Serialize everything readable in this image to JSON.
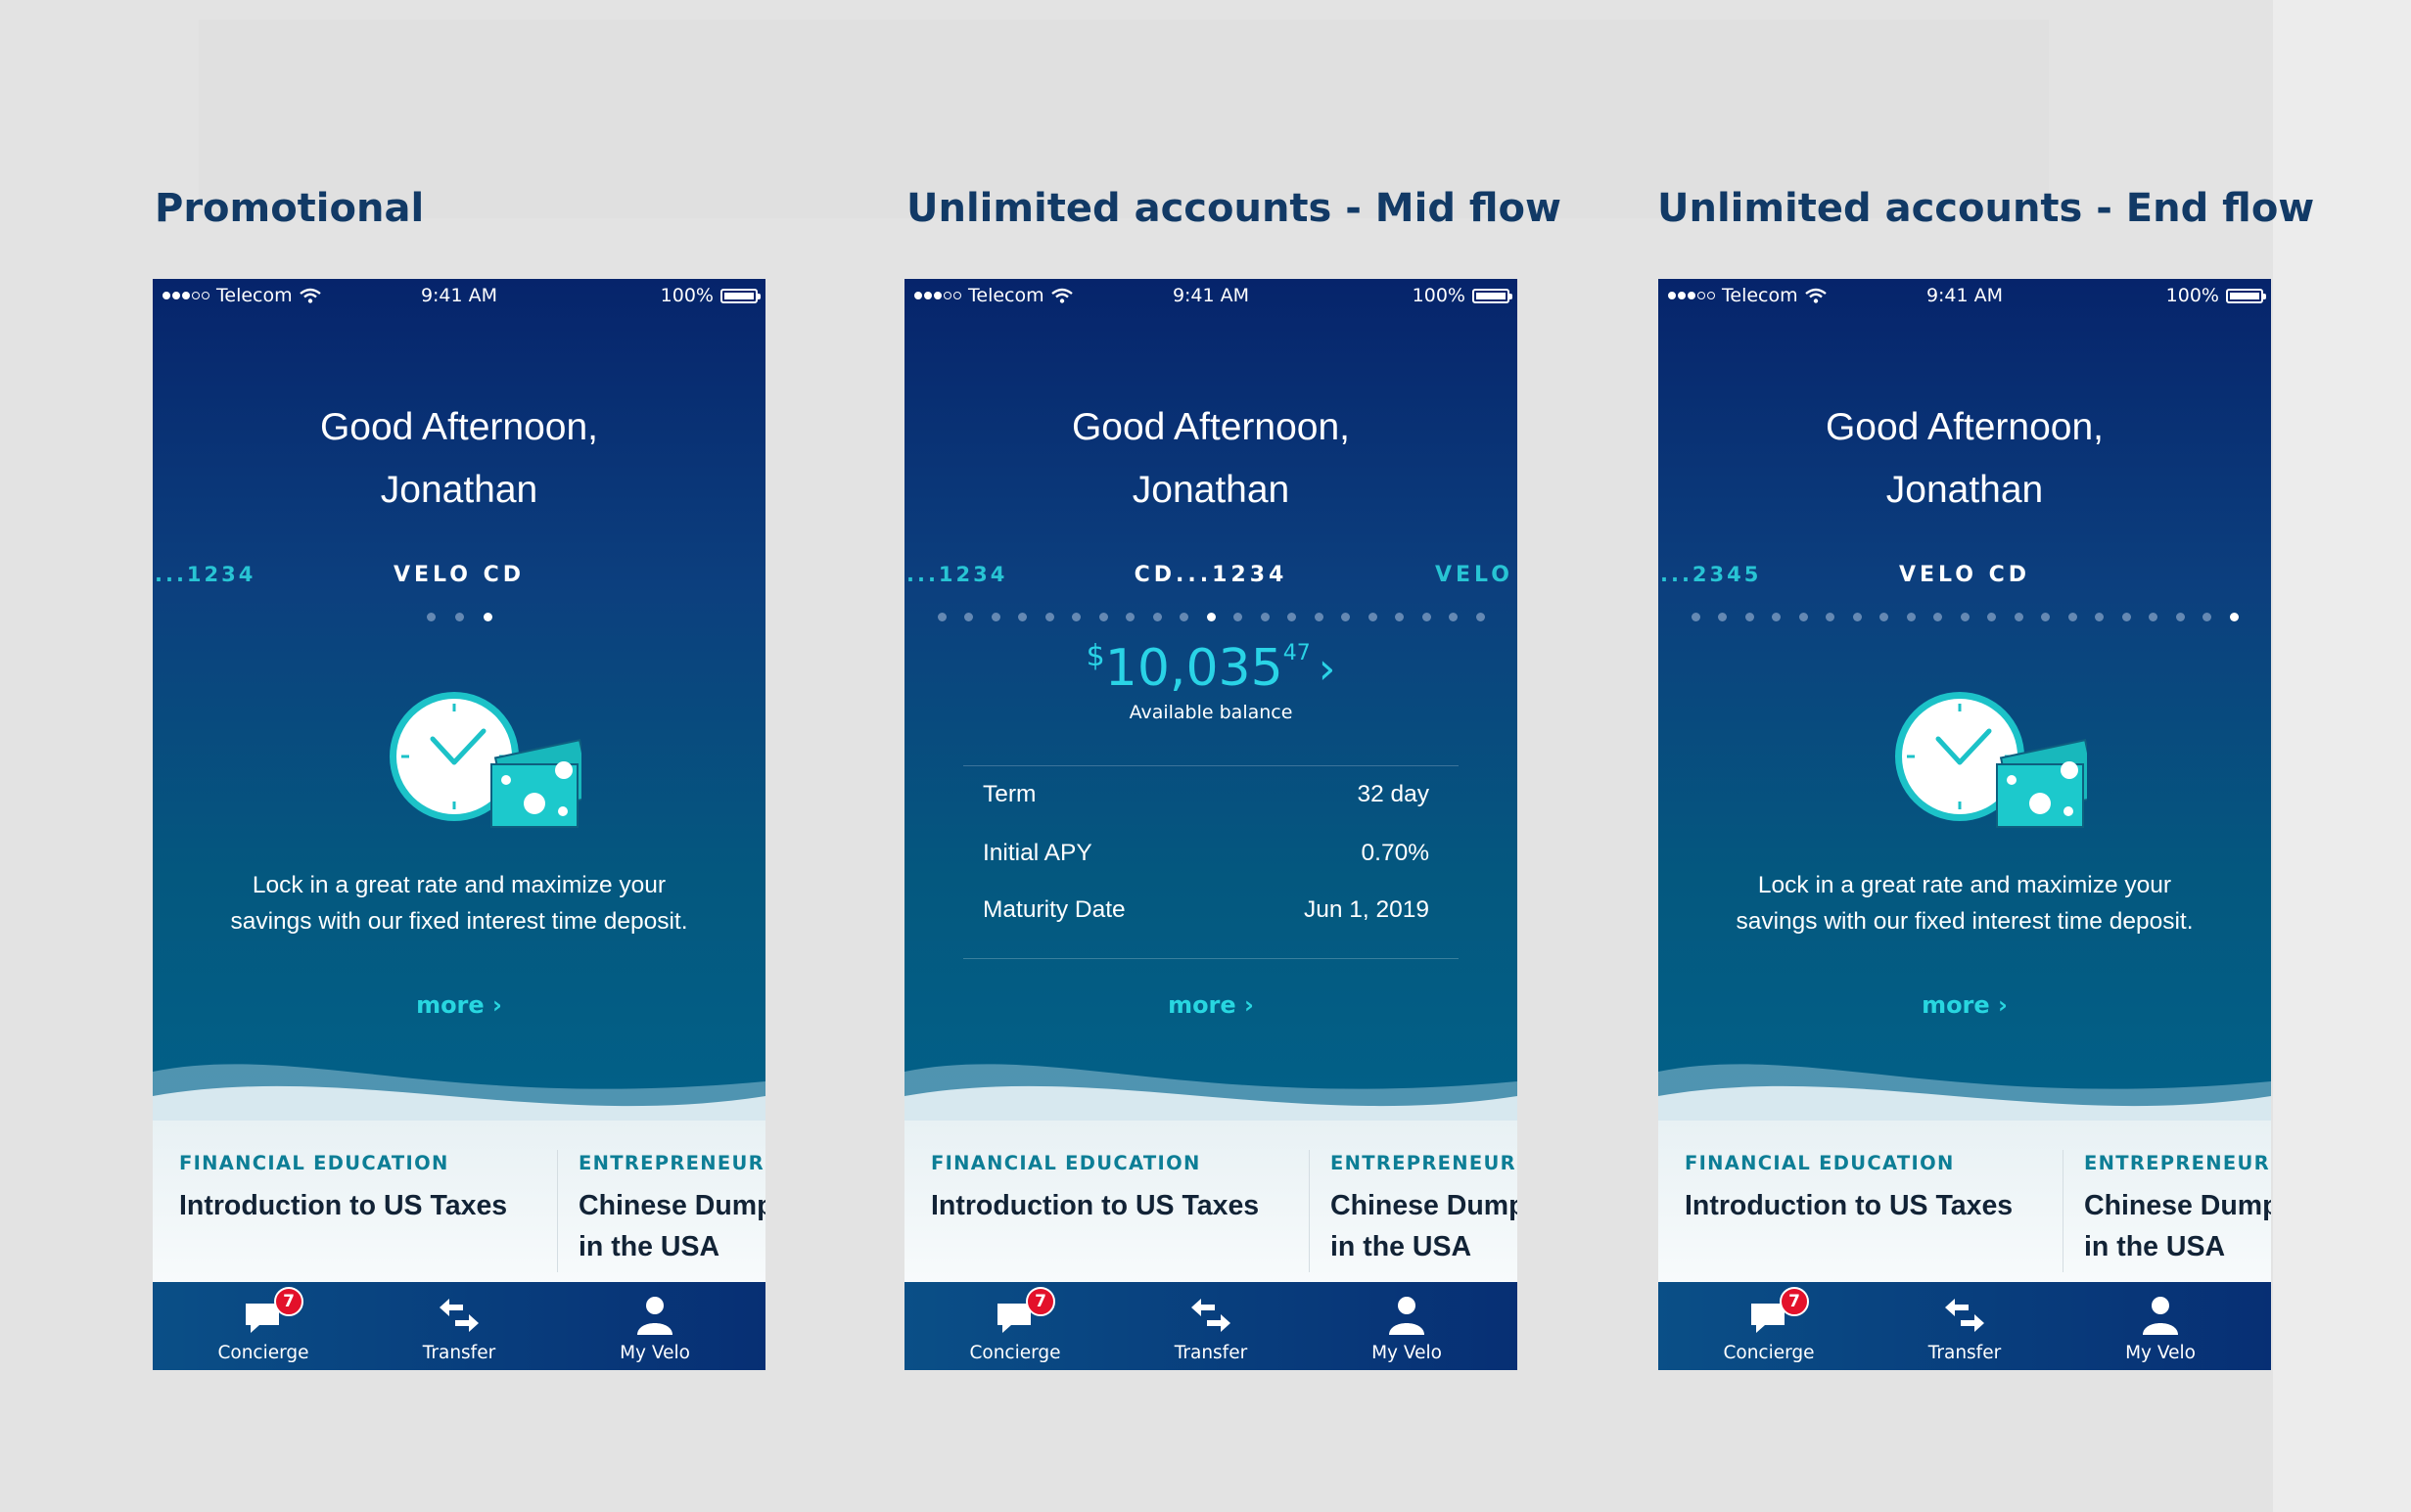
{
  "colors": {
    "title": "#123a66",
    "accent": "#28d6e0",
    "badge": "#e3112a",
    "card_category": "#0d7e96"
  },
  "screens": [
    {
      "title": "Promotional",
      "status": {
        "carrier": "Telecom",
        "time": "9:41 AM",
        "battery": "100%"
      },
      "greeting": {
        "line1": "Good Afternoon,",
        "line2": "Jonathan"
      },
      "account_left": "...1234",
      "account_center": "VELO CD",
      "account_right": "",
      "dots": {
        "count": 3,
        "active": 2
      },
      "promo": {
        "line1": "Lock in a great rate and maximize your",
        "line2": "savings with our fixed interest time deposit."
      },
      "more": "more ›",
      "cards": [
        {
          "category": "FINANCIAL EDUCATION",
          "title_line1": "Introduction to US Taxes",
          "title_line2": ""
        },
        {
          "category": "ENTREPRENEURSHIP",
          "title_line1": "Chinese Dumplings",
          "title_line2": "in the USA"
        }
      ],
      "tabs": [
        {
          "label": "Concierge",
          "icon": "chat-icon",
          "badge": "7"
        },
        {
          "label": "Transfer",
          "icon": "transfer-arrows-icon"
        },
        {
          "label": "My Velo",
          "icon": "user-icon"
        }
      ]
    },
    {
      "title": "Unlimited accounts - Mid flow",
      "status": {
        "carrier": "Telecom",
        "time": "9:41 AM",
        "battery": "100%"
      },
      "greeting": {
        "line1": "Good Afternoon,",
        "line2": "Jonathan"
      },
      "account_left": "...1234",
      "account_center": "CD...1234",
      "account_right": "VELO",
      "dots": {
        "count": 21,
        "active": 10
      },
      "balance": {
        "currency": "$",
        "amount": "10,035",
        "cents": "47",
        "label": "Available balance"
      },
      "details": [
        {
          "label": "Term",
          "value": "32 day"
        },
        {
          "label": "Initial APY",
          "value": "0.70%"
        },
        {
          "label": "Maturity Date",
          "value": "Jun 1, 2019"
        }
      ],
      "more": "more ›",
      "cards": [
        {
          "category": "FINANCIAL EDUCATION",
          "title_line1": "Introduction to US Taxes",
          "title_line2": ""
        },
        {
          "category": "ENTREPRENEURSHIP",
          "title_line1": "Chinese Dumplings",
          "title_line2": "in the USA"
        }
      ],
      "tabs": [
        {
          "label": "Concierge",
          "icon": "chat-icon",
          "badge": "7"
        },
        {
          "label": "Transfer",
          "icon": "transfer-arrows-icon"
        },
        {
          "label": "My Velo",
          "icon": "user-icon"
        }
      ]
    },
    {
      "title": "Unlimited accounts - End flow",
      "status": {
        "carrier": "Telecom",
        "time": "9:41 AM",
        "battery": "100%"
      },
      "greeting": {
        "line1": "Good Afternoon,",
        "line2": "Jonathan"
      },
      "account_left": "...2345",
      "account_center": "VELO CD",
      "account_right": "",
      "dots": {
        "count": 21,
        "active": 20
      },
      "promo": {
        "line1": "Lock in a great rate and maximize your",
        "line2": "savings with our fixed interest time deposit."
      },
      "more": "more ›",
      "cards": [
        {
          "category": "FINANCIAL EDUCATION",
          "title_line1": "Introduction to US Taxes",
          "title_line2": ""
        },
        {
          "category": "ENTREPRENEURSHIP",
          "title_line1": "Chinese Dumplings",
          "title_line2": "in the USA"
        }
      ],
      "tabs": [
        {
          "label": "Concierge",
          "icon": "chat-icon",
          "badge": "7"
        },
        {
          "label": "Transfer",
          "icon": "transfer-arrows-icon"
        },
        {
          "label": "My Velo",
          "icon": "user-icon"
        }
      ]
    }
  ]
}
